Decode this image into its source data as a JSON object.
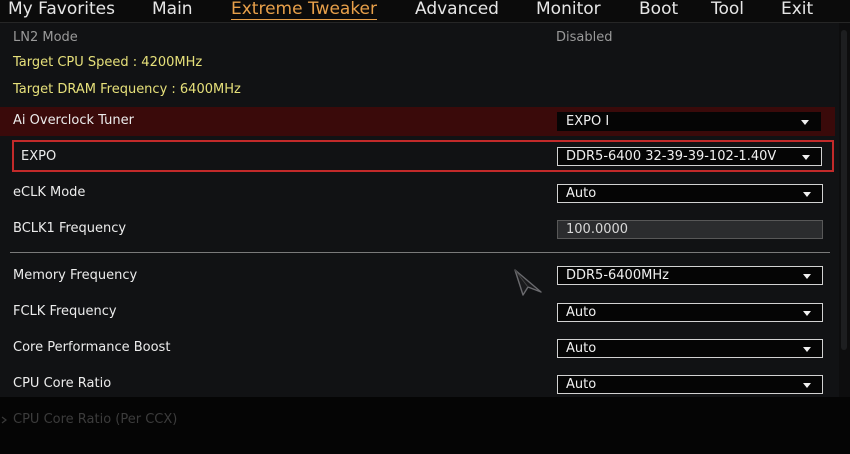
{
  "nav": {
    "tabs": [
      {
        "label": "My Favorites"
      },
      {
        "label": "Main"
      },
      {
        "label": "Extreme Tweaker"
      },
      {
        "label": "Advanced"
      },
      {
        "label": "Monitor"
      },
      {
        "label": "Boot"
      },
      {
        "label": "Tool"
      },
      {
        "label": "Exit"
      }
    ],
    "active": "Extreme Tweaker"
  },
  "info": {
    "ln2_label": "LN2 Mode",
    "ln2_value": "Disabled",
    "target_cpu": "Target CPU Speed : 4200MHz",
    "target_dram": "Target DRAM Frequency : 6400MHz"
  },
  "settings": {
    "ai_overclock": {
      "label": "Ai Overclock Tuner",
      "value": "EXPO I"
    },
    "expo": {
      "label": "EXPO",
      "value": "DDR5-6400 32-39-39-102-1.40V"
    },
    "eclk": {
      "label": "eCLK Mode",
      "value": "Auto"
    },
    "bclk": {
      "label": "BCLK1 Frequency",
      "value": "100.0000"
    },
    "memory_freq": {
      "label": "Memory Frequency",
      "value": "DDR5-6400MHz"
    },
    "fclk": {
      "label": "FCLK Frequency",
      "value": "Auto"
    },
    "cpb": {
      "label": "Core Performance Boost",
      "value": "Auto"
    },
    "cpu_ratio": {
      "label": "CPU Core Ratio",
      "value": "Auto"
    },
    "cpu_ratio_ccx": {
      "label": "CPU Core Ratio (Per CCX)"
    }
  },
  "colors": {
    "accent": "#e8a04a",
    "highlight_border": "#c22a2a",
    "highlight_bg": "#3a0a0a",
    "yellow_text": "#e6e07a"
  },
  "icons": {
    "dropdown": "caret-down-icon",
    "pointer": "mouse-pointer-icon",
    "submenu": "chevron-right-icon"
  }
}
